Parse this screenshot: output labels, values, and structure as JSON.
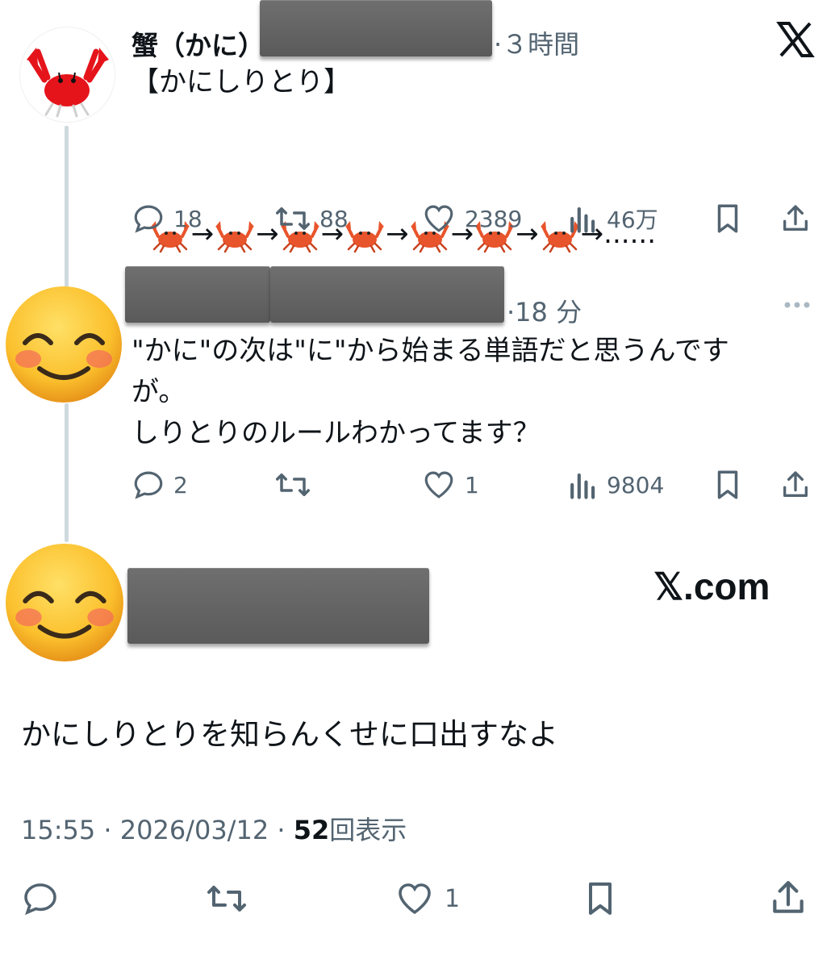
{
  "tweet1": {
    "name": "蟹（かに）",
    "time": "·３時間",
    "line1": "【かにしりとり】",
    "line2": "🦀→🦀→🦀→🦀→🦀→🦀→🦀→......",
    "reply_count": "18",
    "retweet_count": "88",
    "like_count": "2389",
    "view_count": "46万"
  },
  "tweet2": {
    "time": "·18 分",
    "body": "\"かに\"の次は\"に\"から始まる単語だと思うんです\nが。\nしりとりのルールわかってます？",
    "reply_count": "2",
    "like_count": "1",
    "view_count": "9804"
  },
  "tweet3": {
    "watermark": "𝕏.com",
    "body": "かにしりとりを知らんくせに口出すなよ",
    "meta_time": "15:55 · 2026/03/12 · ",
    "meta_views": "52",
    "meta_views_suffix": "回表示",
    "like_count": "1"
  },
  "colors": {
    "text": "#0f1419",
    "secondary": "#536471",
    "line": "#cfd9de"
  },
  "icons": [
    "x-logo-icon",
    "reply-icon",
    "retweet-icon",
    "like-icon",
    "views-icon",
    "bookmark-icon",
    "share-icon",
    "more-icon"
  ]
}
